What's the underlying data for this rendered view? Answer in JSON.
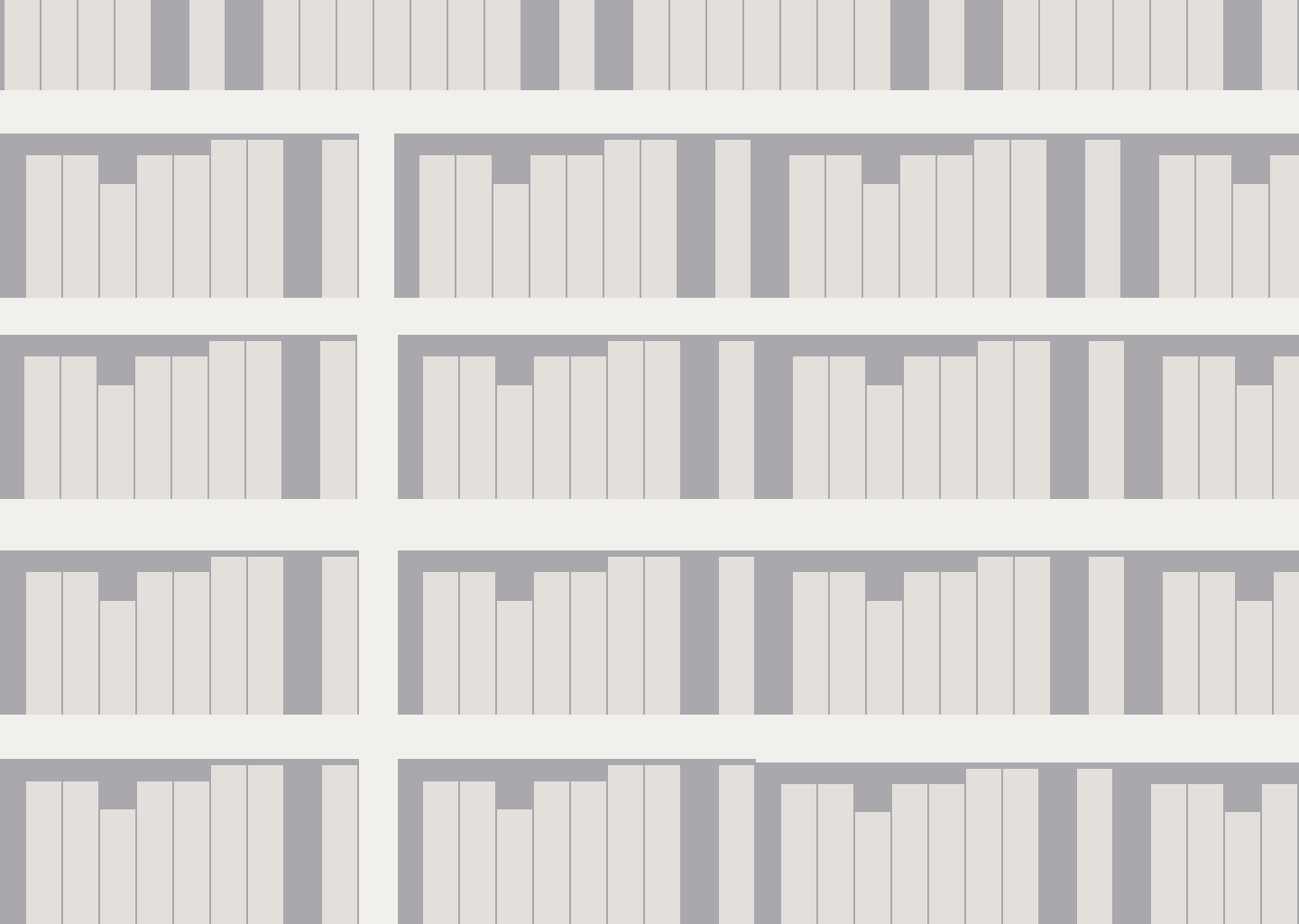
{
  "colors": {
    "wall": "#f1f0ec",
    "shelf_back": "#aaa8ad",
    "book_spine": "#e3e0dc",
    "book_divider": "#aaa8ad"
  },
  "shelf_pattern": {
    "book_heights_relative": [
      0.0,
      0.9,
      0.9,
      0.72,
      0.9,
      0.9,
      1.0,
      1.0,
      0.0,
      1.0
    ]
  }
}
